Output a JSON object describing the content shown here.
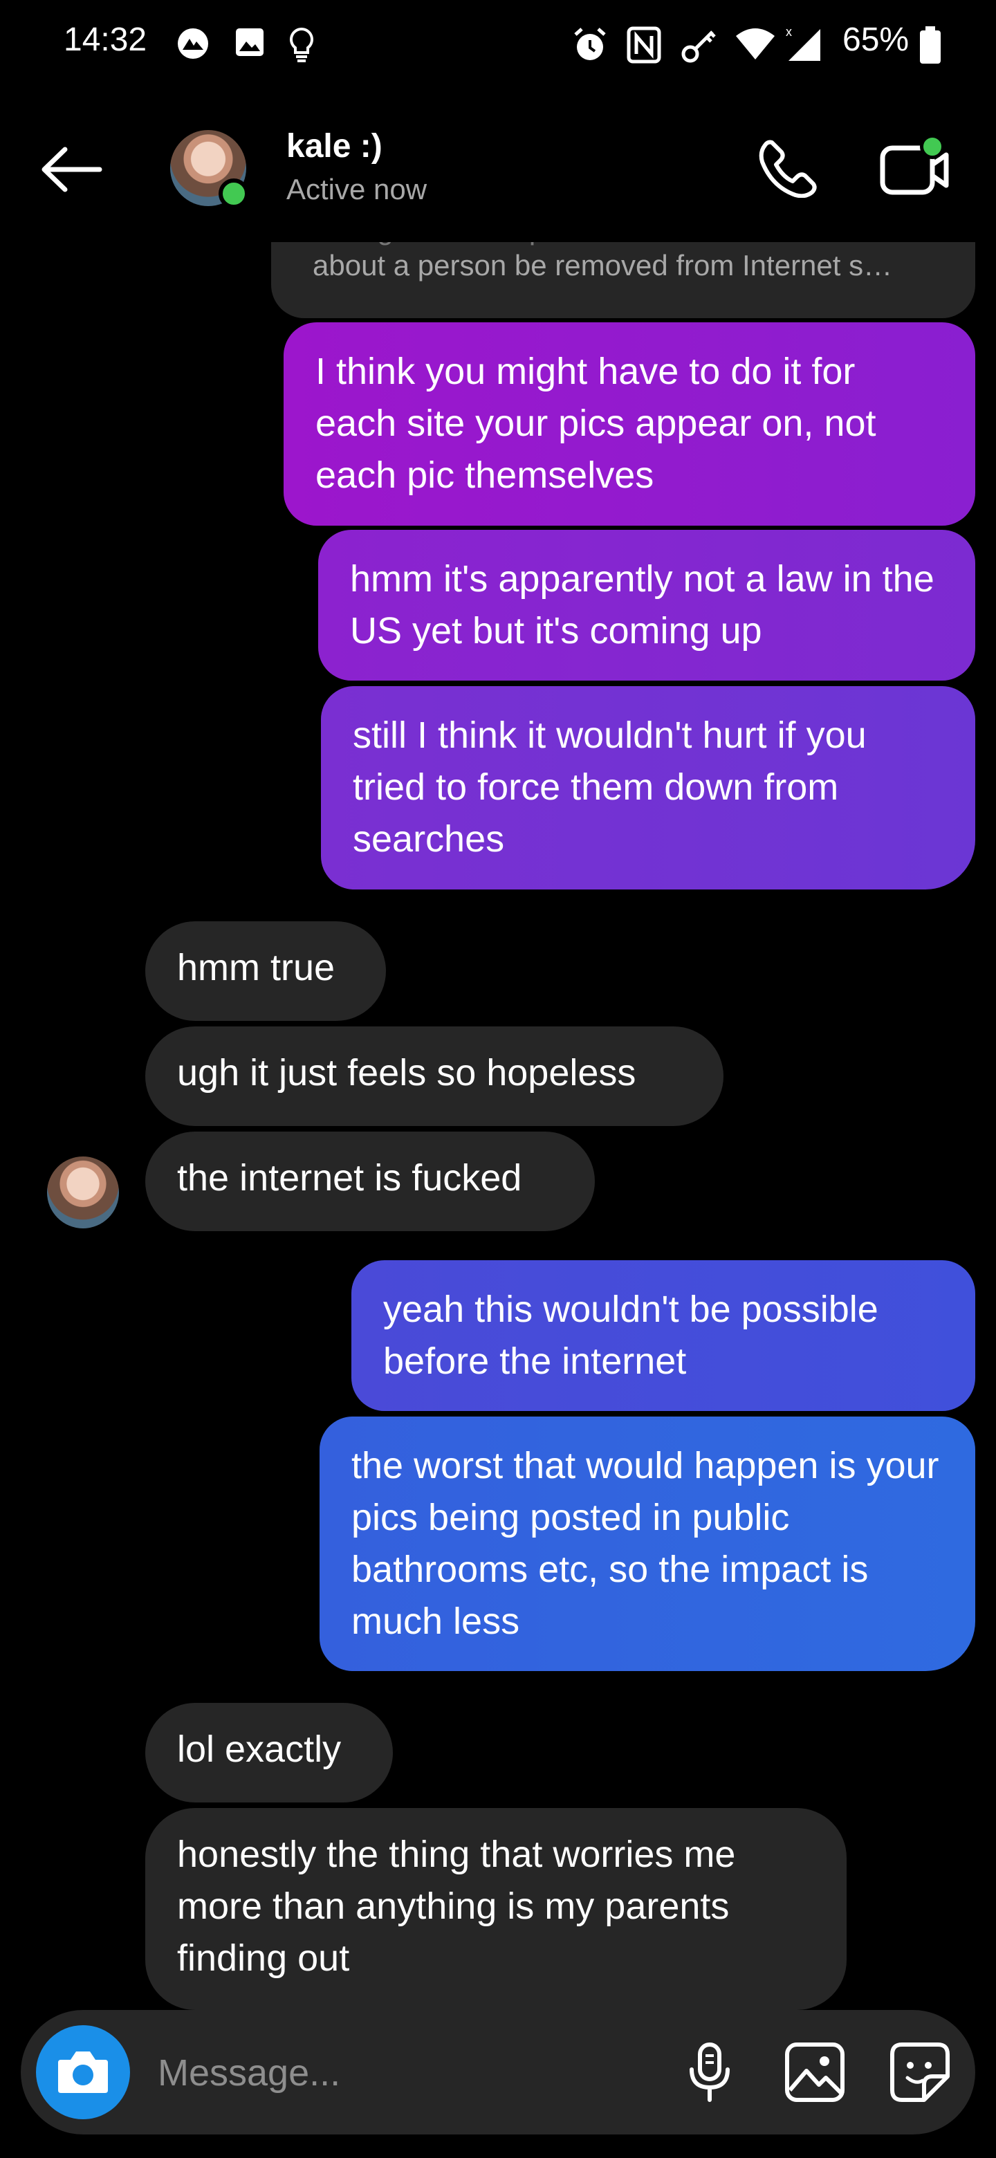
{
  "status_bar": {
    "time": "14:32",
    "battery": "65%",
    "icons": [
      "vpn-icon",
      "image-icon",
      "bulb-icon",
      "alarm-icon",
      "nfc-icon",
      "key-icon",
      "wifi-icon",
      "signal-icon",
      "battery-icon"
    ]
  },
  "header": {
    "name": "kale :)",
    "status": "Active now",
    "icons": [
      "back-arrow-icon",
      "phone-icon",
      "video-call-icon"
    ],
    "online_color": "#42c952"
  },
  "quoted": {
    "faded_line": "the right to have private information",
    "text": "about a person be removed from Internet s…"
  },
  "messages": [
    {
      "dir": "out",
      "text": "I think you might have to do it for each site your pics appear on, not each pic themselves"
    },
    {
      "dir": "out",
      "text": "hmm it's apparently not a law in the US yet but it's coming up"
    },
    {
      "dir": "out",
      "text": "still I think it wouldn't hurt if you tried to force them down from searches"
    },
    {
      "dir": "in",
      "text": "hmm true"
    },
    {
      "dir": "in",
      "text": "ugh it just feels so hopeless"
    },
    {
      "dir": "in",
      "text": "the internet is fucked"
    },
    {
      "dir": "out",
      "text": "yeah this wouldn't be possible before the internet"
    },
    {
      "dir": "out",
      "text": "the worst that would happen is your pics being posted in public bathrooms etc, so the impact is much less"
    },
    {
      "dir": "in",
      "text": "lol exactly"
    },
    {
      "dir": "in",
      "text": "honestly the thing that worries me more than anything is my parents finding out"
    }
  ],
  "composer": {
    "placeholder": "Message...",
    "icons": [
      "camera-icon",
      "microphone-icon",
      "gallery-icon",
      "sticker-icon"
    ],
    "camera_color": "#1a8fe8"
  },
  "colors": {
    "background": "#000000",
    "incoming_bubble": "#262626",
    "outgoing_gradient": [
      "#9c1ac8",
      "#2f6ae0"
    ]
  }
}
